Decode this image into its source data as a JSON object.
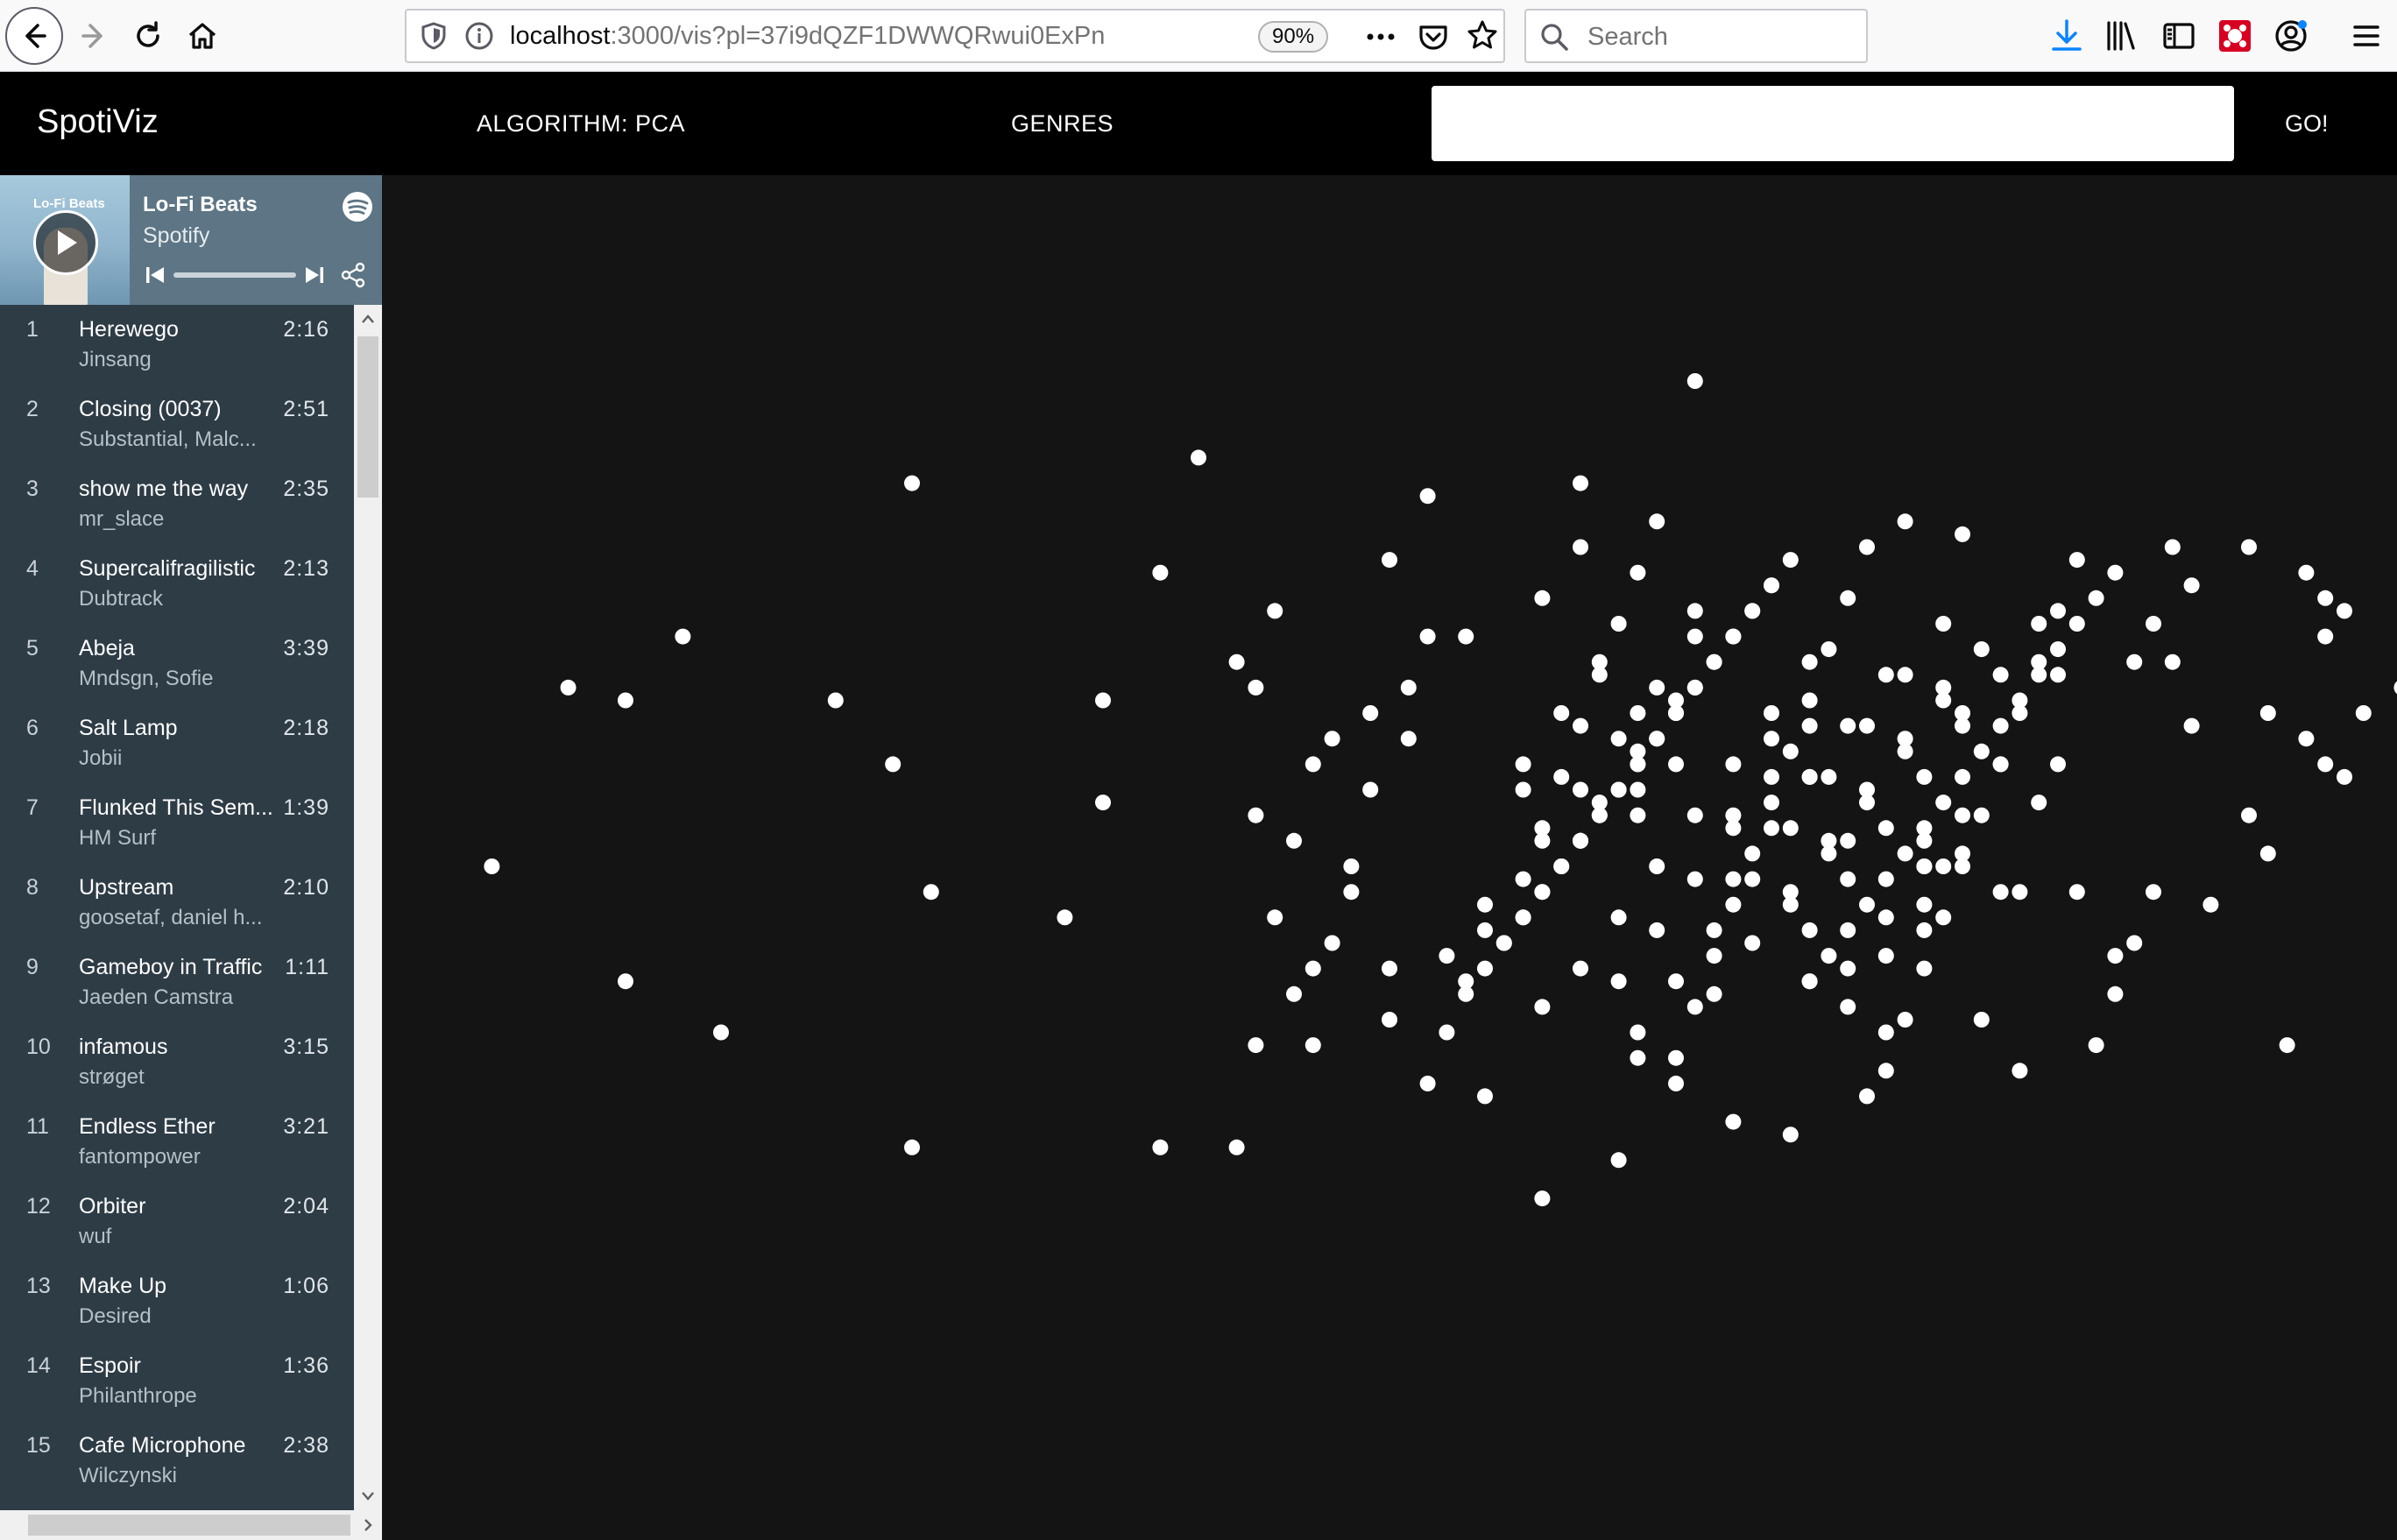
{
  "browser": {
    "url_host": "localhost",
    "url_path": ":3000/vis?pl=37i9dQZF1DWWQRwui0ExPn",
    "zoom": "90%",
    "search_placeholder": "Search"
  },
  "header": {
    "brand": "SpotiViz",
    "algorithm_label": "ALGORITHM: PCA",
    "genres_label": "GENRES",
    "playlist_input_value": "",
    "go_label": "GO!"
  },
  "embed": {
    "cover_title": "Lo-Fi Beats",
    "playlist_title": "Lo-Fi Beats",
    "owner": "Spotify",
    "tracks": [
      {
        "num": "1",
        "title": "Herewego",
        "artist": "Jinsang",
        "duration": "2:16"
      },
      {
        "num": "2",
        "title": "Closing (0037)",
        "artist": "Substantial, Malc...",
        "duration": "2:51"
      },
      {
        "num": "3",
        "title": "show me the way",
        "artist": "mr_slace",
        "duration": "2:35"
      },
      {
        "num": "4",
        "title": "Supercalifragilistic",
        "artist": "Dubtrack",
        "duration": "2:13"
      },
      {
        "num": "5",
        "title": "Abeja",
        "artist": "Mndsgn, Sofie",
        "duration": "3:39"
      },
      {
        "num": "6",
        "title": "Salt Lamp",
        "artist": "Jobii",
        "duration": "2:18"
      },
      {
        "num": "7",
        "title": "Flunked This Sem...",
        "artist": "HM Surf",
        "duration": "1:39"
      },
      {
        "num": "8",
        "title": "Upstream",
        "artist": "goosetaf, daniel h...",
        "duration": "2:10"
      },
      {
        "num": "9",
        "title": "Gameboy in Traffic",
        "artist": "Jaeden Camstra",
        "duration": "1:11"
      },
      {
        "num": "10",
        "title": "infamous",
        "artist": "strøget",
        "duration": "3:15"
      },
      {
        "num": "11",
        "title": "Endless Ether",
        "artist": "fantompower",
        "duration": "3:21"
      },
      {
        "num": "12",
        "title": "Orbiter",
        "artist": "wuf",
        "duration": "2:04"
      },
      {
        "num": "13",
        "title": "Make Up",
        "artist": "Desired",
        "duration": "1:06"
      },
      {
        "num": "14",
        "title": "Espoir",
        "artist": "Philanthrope",
        "duration": "1:36"
      },
      {
        "num": "15",
        "title": "Cafe Microphone",
        "artist": "Wilczynski",
        "duration": "2:38"
      }
    ]
  },
  "colors": {
    "header_bg": "#000000",
    "vis_bg": "#141414",
    "point": "#ffffff",
    "embed_bg": "#2e3c46",
    "embed_head_bg": "#5d7584"
  },
  "chart_data": {
    "type": "scatter",
    "title": "",
    "xlabel": "",
    "ylabel": "",
    "axes_visible": false,
    "grid": false,
    "xlim": [
      0,
      100
    ],
    "ylim": [
      0,
      100
    ],
    "x": [
      3,
      10,
      15,
      13,
      21,
      7,
      10,
      25,
      24,
      25,
      26,
      33,
      35,
      35,
      38,
      40,
      38,
      43,
      50,
      52,
      42,
      52,
      58,
      60,
      60,
      66,
      63,
      66,
      70,
      72,
      77,
      80,
      85,
      97,
      98,
      91,
      98,
      92,
      99,
      101,
      100,
      107,
      107,
      100,
      99,
      103,
      110,
      105,
      58,
      62,
      55,
      58,
      53,
      55,
      60,
      57,
      51,
      51,
      54,
      63,
      65,
      68,
      71,
      75,
      76,
      72,
      78,
      82,
      78,
      84,
      85,
      80,
      89,
      90,
      92,
      95,
      88,
      93,
      96,
      95,
      99,
      96,
      91,
      83,
      57,
      63,
      68,
      74,
      79,
      86,
      46,
      45,
      47,
      48,
      45,
      49,
      47,
      43,
      50,
      46,
      44,
      48,
      43,
      46,
      49,
      42,
      44,
      50,
      52,
      53,
      54,
      55,
      57,
      58,
      59,
      60,
      61,
      62,
      63,
      64,
      65,
      66,
      67,
      68,
      69,
      70,
      71,
      72,
      73,
      74,
      75,
      76,
      77,
      78,
      79,
      80,
      81,
      82,
      83,
      84,
      85,
      86,
      87,
      88,
      89,
      90,
      54,
      56,
      58,
      60,
      62,
      64,
      66,
      68,
      70,
      72,
      74,
      76,
      78,
      80,
      82,
      84,
      86,
      88,
      55,
      57,
      59,
      61,
      63,
      65,
      67,
      69,
      71,
      73,
      75,
      77,
      79,
      81,
      83,
      85,
      87,
      56,
      58,
      60,
      62,
      64,
      66,
      68,
      70,
      72,
      74,
      76,
      78,
      80,
      82,
      84,
      57,
      59,
      61,
      63,
      65,
      67,
      69,
      71,
      73,
      75,
      77,
      79,
      81,
      83,
      58,
      60,
      62,
      64,
      66,
      68,
      70,
      72,
      74,
      76,
      78,
      80,
      82,
      59,
      61,
      63,
      65,
      67,
      69,
      71,
      73,
      75,
      77,
      79,
      81,
      60,
      62,
      64,
      66,
      68,
      70,
      72,
      74,
      76,
      78,
      80,
      61,
      63,
      65,
      67,
      69,
      71,
      73,
      75,
      77,
      79,
      62,
      64,
      66,
      68,
      70,
      72,
      74,
      76,
      78,
      63,
      65,
      67,
      69,
      71,
      73,
      75,
      77,
      64,
      66,
      68,
      70,
      72,
      74,
      76
    ],
    "y": [
      50,
      41,
      37,
      68,
      63,
      64,
      63,
      80,
      58,
      28,
      48,
      46,
      55,
      63,
      73,
      82,
      28,
      36,
      42,
      79,
      28,
      68,
      71,
      75,
      80,
      70,
      62,
      88,
      60,
      57,
      77,
      76,
      65,
      36,
      60,
      75,
      73,
      61,
      68,
      62,
      57,
      56,
      63,
      70,
      71,
      64,
      44,
      38,
      24,
      27,
      32,
      39,
      43,
      47,
      52,
      56,
      60,
      64,
      68,
      35,
      33,
      30,
      29,
      32,
      37,
      41,
      45,
      48,
      52,
      55,
      58,
      62,
      66,
      69,
      72,
      75,
      43,
      47,
      51,
      54,
      58,
      62,
      66,
      34,
      58,
      56,
      54,
      52,
      50,
      48,
      36,
      40,
      44,
      48,
      52,
      56,
      60,
      64,
      38,
      42,
      46,
      50,
      54,
      58,
      62,
      66,
      70,
      74,
      33,
      37,
      41,
      45,
      49,
      53,
      57,
      61,
      65,
      69,
      73,
      77,
      35,
      39,
      43,
      47,
      51,
      55,
      59,
      63,
      67,
      71,
      75,
      34,
      38,
      42,
      46,
      50,
      54,
      58,
      62,
      66,
      70,
      74,
      36,
      40,
      44,
      48,
      40,
      44,
      48,
      52,
      56,
      60,
      64,
      68,
      72,
      41,
      45,
      49,
      53,
      57,
      61,
      65,
      69,
      73,
      42,
      46,
      50,
      54,
      58,
      62,
      66,
      70,
      74,
      43,
      47,
      51,
      55,
      59,
      63,
      67,
      71,
      44,
      48,
      52,
      56,
      60,
      64,
      68,
      72,
      45,
      49,
      53,
      57,
      61,
      65,
      69,
      46,
      50,
      54,
      58,
      62,
      66,
      70,
      47,
      51,
      55,
      59,
      63,
      67,
      48,
      52,
      56,
      60,
      64,
      68,
      49,
      53,
      57,
      61,
      65,
      50,
      54,
      58,
      62,
      66,
      37,
      41,
      45,
      49,
      53,
      57,
      61,
      65,
      69,
      38,
      42,
      46,
      50,
      54,
      58,
      62,
      66,
      39,
      43,
      47,
      51,
      55,
      59,
      63,
      40,
      44,
      48,
      52,
      56,
      60,
      64,
      41,
      45,
      49,
      53,
      57,
      61,
      42,
      46,
      50,
      54,
      58
    ]
  }
}
